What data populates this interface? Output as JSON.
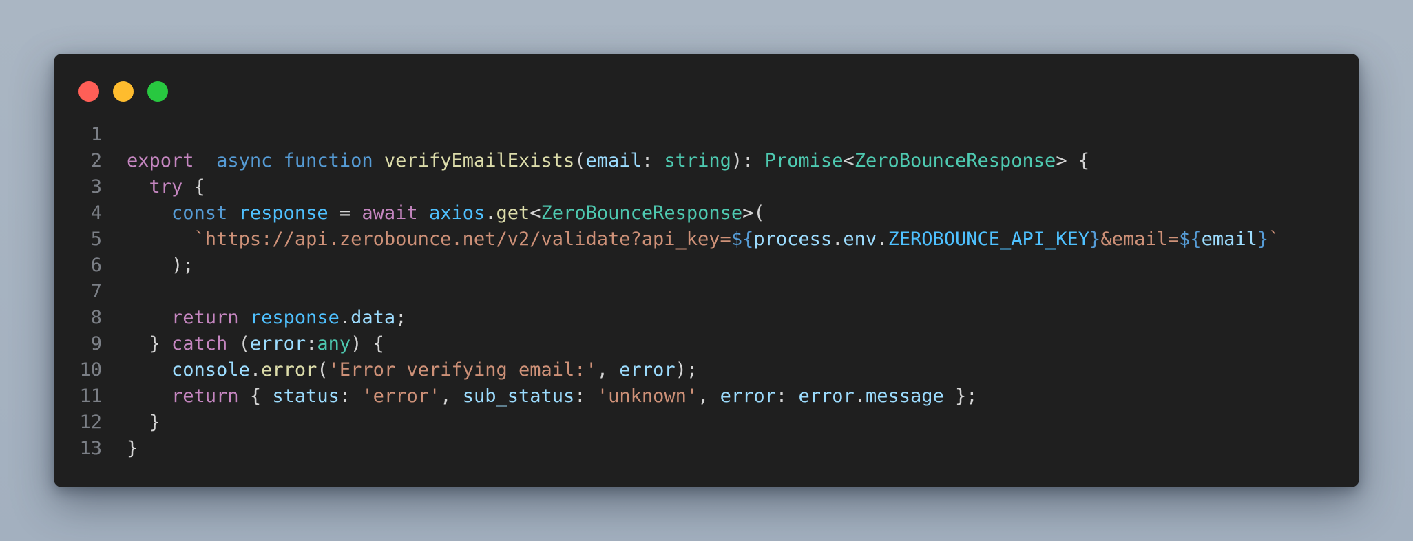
{
  "colors": {
    "background": "#a8b4c2",
    "window": "#1f1f1f",
    "line_number": "#7b7f86",
    "default": "#d4d4d4"
  },
  "traffic_lights": [
    {
      "name": "close-dot",
      "color": "#ff5f57"
    },
    {
      "name": "minimize-dot",
      "color": "#febc2e"
    },
    {
      "name": "zoom-dot",
      "color": "#28c840"
    }
  ],
  "code_lines": [
    {
      "n": "1",
      "tokens": []
    },
    {
      "n": "2",
      "tokens": [
        {
          "t": "export",
          "c": "#c586c0"
        },
        {
          "t": "  ",
          "c": "#d4d4d4"
        },
        {
          "t": "async",
          "c": "#569cd6"
        },
        {
          "t": " ",
          "c": "#d4d4d4"
        },
        {
          "t": "function",
          "c": "#569cd6"
        },
        {
          "t": " ",
          "c": "#d4d4d4"
        },
        {
          "t": "verifyEmailExists",
          "c": "#dcdcaa"
        },
        {
          "t": "(",
          "c": "#d4d4d4"
        },
        {
          "t": "email",
          "c": "#9cdcfe"
        },
        {
          "t": ": ",
          "c": "#d4d4d4"
        },
        {
          "t": "string",
          "c": "#4ec9b0"
        },
        {
          "t": "): ",
          "c": "#d4d4d4"
        },
        {
          "t": "Promise",
          "c": "#4ec9b0"
        },
        {
          "t": "<",
          "c": "#d4d4d4"
        },
        {
          "t": "ZeroBounceResponse",
          "c": "#4ec9b0"
        },
        {
          "t": "> {",
          "c": "#d4d4d4"
        }
      ]
    },
    {
      "n": "3",
      "tokens": [
        {
          "t": "  ",
          "c": "#d4d4d4"
        },
        {
          "t": "try",
          "c": "#c586c0"
        },
        {
          "t": " {",
          "c": "#d4d4d4"
        }
      ]
    },
    {
      "n": "4",
      "tokens": [
        {
          "t": "    ",
          "c": "#d4d4d4"
        },
        {
          "t": "const",
          "c": "#569cd6"
        },
        {
          "t": " ",
          "c": "#d4d4d4"
        },
        {
          "t": "response",
          "c": "#4fc1ff"
        },
        {
          "t": " = ",
          "c": "#d4d4d4"
        },
        {
          "t": "await",
          "c": "#c586c0"
        },
        {
          "t": " ",
          "c": "#d4d4d4"
        },
        {
          "t": "axios",
          "c": "#4fc1ff"
        },
        {
          "t": ".",
          "c": "#d4d4d4"
        },
        {
          "t": "get",
          "c": "#dcdcaa"
        },
        {
          "t": "<",
          "c": "#d4d4d4"
        },
        {
          "t": "ZeroBounceResponse",
          "c": "#4ec9b0"
        },
        {
          "t": ">(",
          "c": "#d4d4d4"
        }
      ]
    },
    {
      "n": "5",
      "tokens": [
        {
          "t": "      ",
          "c": "#d4d4d4"
        },
        {
          "t": "`https://api.zerobounce.net/v2/validate?api_key=",
          "c": "#ce9178"
        },
        {
          "t": "${",
          "c": "#569cd6"
        },
        {
          "t": "process",
          "c": "#9cdcfe"
        },
        {
          "t": ".",
          "c": "#d4d4d4"
        },
        {
          "t": "env",
          "c": "#9cdcfe"
        },
        {
          "t": ".",
          "c": "#d4d4d4"
        },
        {
          "t": "ZEROBOUNCE_API_KEY",
          "c": "#4fc1ff"
        },
        {
          "t": "}",
          "c": "#569cd6"
        },
        {
          "t": "&email=",
          "c": "#ce9178"
        },
        {
          "t": "${",
          "c": "#569cd6"
        },
        {
          "t": "email",
          "c": "#9cdcfe"
        },
        {
          "t": "}",
          "c": "#569cd6"
        },
        {
          "t": "`",
          "c": "#ce9178"
        }
      ]
    },
    {
      "n": "6",
      "tokens": [
        {
          "t": "    );",
          "c": "#d4d4d4"
        }
      ]
    },
    {
      "n": "7",
      "tokens": []
    },
    {
      "n": "8",
      "tokens": [
        {
          "t": "    ",
          "c": "#d4d4d4"
        },
        {
          "t": "return",
          "c": "#c586c0"
        },
        {
          "t": " ",
          "c": "#d4d4d4"
        },
        {
          "t": "response",
          "c": "#4fc1ff"
        },
        {
          "t": ".",
          "c": "#d4d4d4"
        },
        {
          "t": "data",
          "c": "#9cdcfe"
        },
        {
          "t": ";",
          "c": "#d4d4d4"
        }
      ]
    },
    {
      "n": "9",
      "tokens": [
        {
          "t": "  } ",
          "c": "#d4d4d4"
        },
        {
          "t": "catch",
          "c": "#c586c0"
        },
        {
          "t": " (",
          "c": "#d4d4d4"
        },
        {
          "t": "error",
          "c": "#9cdcfe"
        },
        {
          "t": ":",
          "c": "#d4d4d4"
        },
        {
          "t": "any",
          "c": "#4ec9b0"
        },
        {
          "t": ") {",
          "c": "#d4d4d4"
        }
      ]
    },
    {
      "n": "10",
      "tokens": [
        {
          "t": "    ",
          "c": "#d4d4d4"
        },
        {
          "t": "console",
          "c": "#9cdcfe"
        },
        {
          "t": ".",
          "c": "#d4d4d4"
        },
        {
          "t": "error",
          "c": "#dcdcaa"
        },
        {
          "t": "(",
          "c": "#d4d4d4"
        },
        {
          "t": "'Error verifying email:'",
          "c": "#ce9178"
        },
        {
          "t": ", ",
          "c": "#d4d4d4"
        },
        {
          "t": "error",
          "c": "#9cdcfe"
        },
        {
          "t": ");",
          "c": "#d4d4d4"
        }
      ]
    },
    {
      "n": "11",
      "tokens": [
        {
          "t": "    ",
          "c": "#d4d4d4"
        },
        {
          "t": "return",
          "c": "#c586c0"
        },
        {
          "t": " { ",
          "c": "#d4d4d4"
        },
        {
          "t": "status",
          "c": "#9cdcfe"
        },
        {
          "t": ": ",
          "c": "#d4d4d4"
        },
        {
          "t": "'error'",
          "c": "#ce9178"
        },
        {
          "t": ", ",
          "c": "#d4d4d4"
        },
        {
          "t": "sub_status",
          "c": "#9cdcfe"
        },
        {
          "t": ": ",
          "c": "#d4d4d4"
        },
        {
          "t": "'unknown'",
          "c": "#ce9178"
        },
        {
          "t": ", ",
          "c": "#d4d4d4"
        },
        {
          "t": "error",
          "c": "#9cdcfe"
        },
        {
          "t": ": ",
          "c": "#d4d4d4"
        },
        {
          "t": "error",
          "c": "#9cdcfe"
        },
        {
          "t": ".",
          "c": "#d4d4d4"
        },
        {
          "t": "message",
          "c": "#9cdcfe"
        },
        {
          "t": " };",
          "c": "#d4d4d4"
        }
      ]
    },
    {
      "n": "12",
      "tokens": [
        {
          "t": "  }",
          "c": "#d4d4d4"
        }
      ]
    },
    {
      "n": "13",
      "tokens": [
        {
          "t": "}",
          "c": "#d4d4d4"
        }
      ]
    }
  ]
}
